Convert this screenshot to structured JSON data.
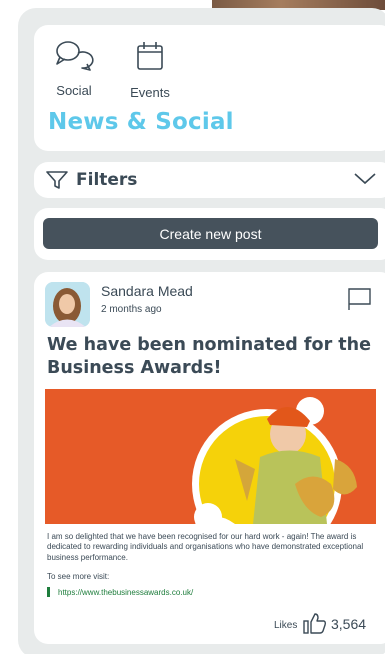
{
  "nav": {
    "tabs": [
      {
        "label": "Social",
        "icon": "chat-bubbles-icon"
      },
      {
        "label": "Events",
        "icon": "calendar-icon"
      }
    ],
    "section_title": "News & Social"
  },
  "filters": {
    "label": "Filters"
  },
  "create_post": {
    "label": "Create new post"
  },
  "post": {
    "author": "Sandara Mead",
    "time": "2 months ago",
    "title": "We have been nominated for the Business Awards!",
    "body": "I am so delighted that we have been recognised for our hard work - again! The award is dedicated to rewarding individuals and organisations who have demonstrated exceptional business performance.",
    "cta": "To see more visit:",
    "link": "https://www.thebusinessawards.co.uk/",
    "likes_label": "Likes",
    "likes_count": "3,564"
  },
  "colors": {
    "accent": "#5ec8ea",
    "button_bg": "#46525c",
    "link": "#1e7d3c",
    "image_bg": "#e65a28",
    "image_circle": "#f5d20a"
  }
}
